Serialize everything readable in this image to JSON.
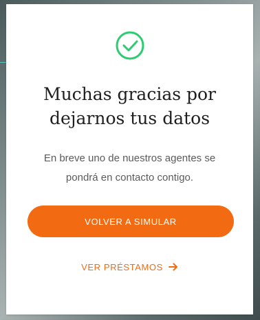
{
  "modal": {
    "title_line1": "Muchas gracias por",
    "title_line2": "dejarnos tus datos",
    "message_line1": "En breve uno de nuestros agentes se",
    "message_line2": "pondrá en contacto contigo.",
    "primary_button_label": "VOLVER A SIMULAR",
    "link_label": "VER PRÉSTAMOS",
    "icons": {
      "success": "check-circle-icon",
      "link": "arrow-right-icon"
    }
  },
  "colors": {
    "accent": "#f26b12",
    "success": "#2ecc71",
    "title_text": "#1f1f1f",
    "body_text": "#5a5a5a"
  }
}
